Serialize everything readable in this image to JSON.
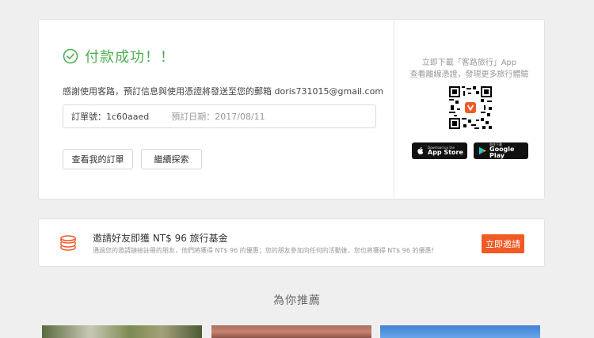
{
  "success": {
    "title": "付款成功！！",
    "message": "感謝使用客路，預訂信息與使用憑證將發送至您的郵箱 doris731015@gmail.com",
    "order_label": "訂單號：",
    "order_number": "1c60aaed",
    "date_label": "預訂日期：",
    "date_value": "2017/08/11",
    "view_orders_button": "查看我的訂單",
    "continue_button": "繼續探索"
  },
  "app": {
    "line1": "立即下載「客路旅行」App",
    "line2": "查看離線憑證，發現更多旅行體驗",
    "apple_small": "Download on the",
    "apple_big": "App Store",
    "google_small": "前往下載",
    "google_big": "Google Play"
  },
  "invite": {
    "title": "邀請好友即獲 NT$ 96 旅行基金",
    "description": "通過您的邀請鏈接註冊的朋友，他們將獲得 NT$ 96 的優惠；您的朋友參加向任何的活動後，您也將獲得 NT$ 96 的優惠！",
    "button": "立即邀請"
  },
  "recommend": {
    "title": "為你推薦"
  },
  "colors": {
    "success_green": "#4caf50",
    "accent_orange": "#f15a24"
  }
}
